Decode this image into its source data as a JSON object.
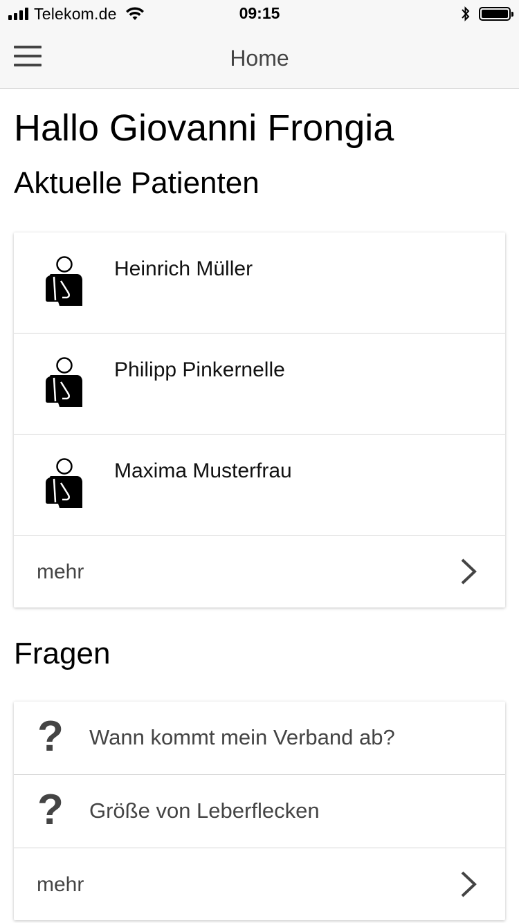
{
  "status_bar": {
    "carrier": "Telekom.de",
    "time": "09:15",
    "signal_icon": "signal-bars-icon",
    "wifi_icon": "wifi-icon",
    "bluetooth_icon": "bluetooth-icon",
    "battery_icon": "battery-icon"
  },
  "nav": {
    "title": "Home",
    "menu_icon": "hamburger-menu-icon"
  },
  "greeting": "Hallo Giovanni Frongia",
  "patients": {
    "title": "Aktuelle Patienten",
    "items": [
      {
        "name": "Heinrich Müller"
      },
      {
        "name": "Philipp Pinkernelle"
      },
      {
        "name": "Maxima Musterfrau"
      }
    ],
    "more_label": "mehr"
  },
  "questions": {
    "title": "Fragen",
    "items": [
      {
        "icon": "?",
        "text": "Wann kommt mein Verband ab?"
      },
      {
        "icon": "?",
        "text": "Größe von Leberflecken"
      }
    ],
    "more_label": "mehr"
  },
  "colors": {
    "bar_background": "#f7f7f7",
    "text_secondary": "#444444",
    "divider": "#d6d6d6"
  }
}
